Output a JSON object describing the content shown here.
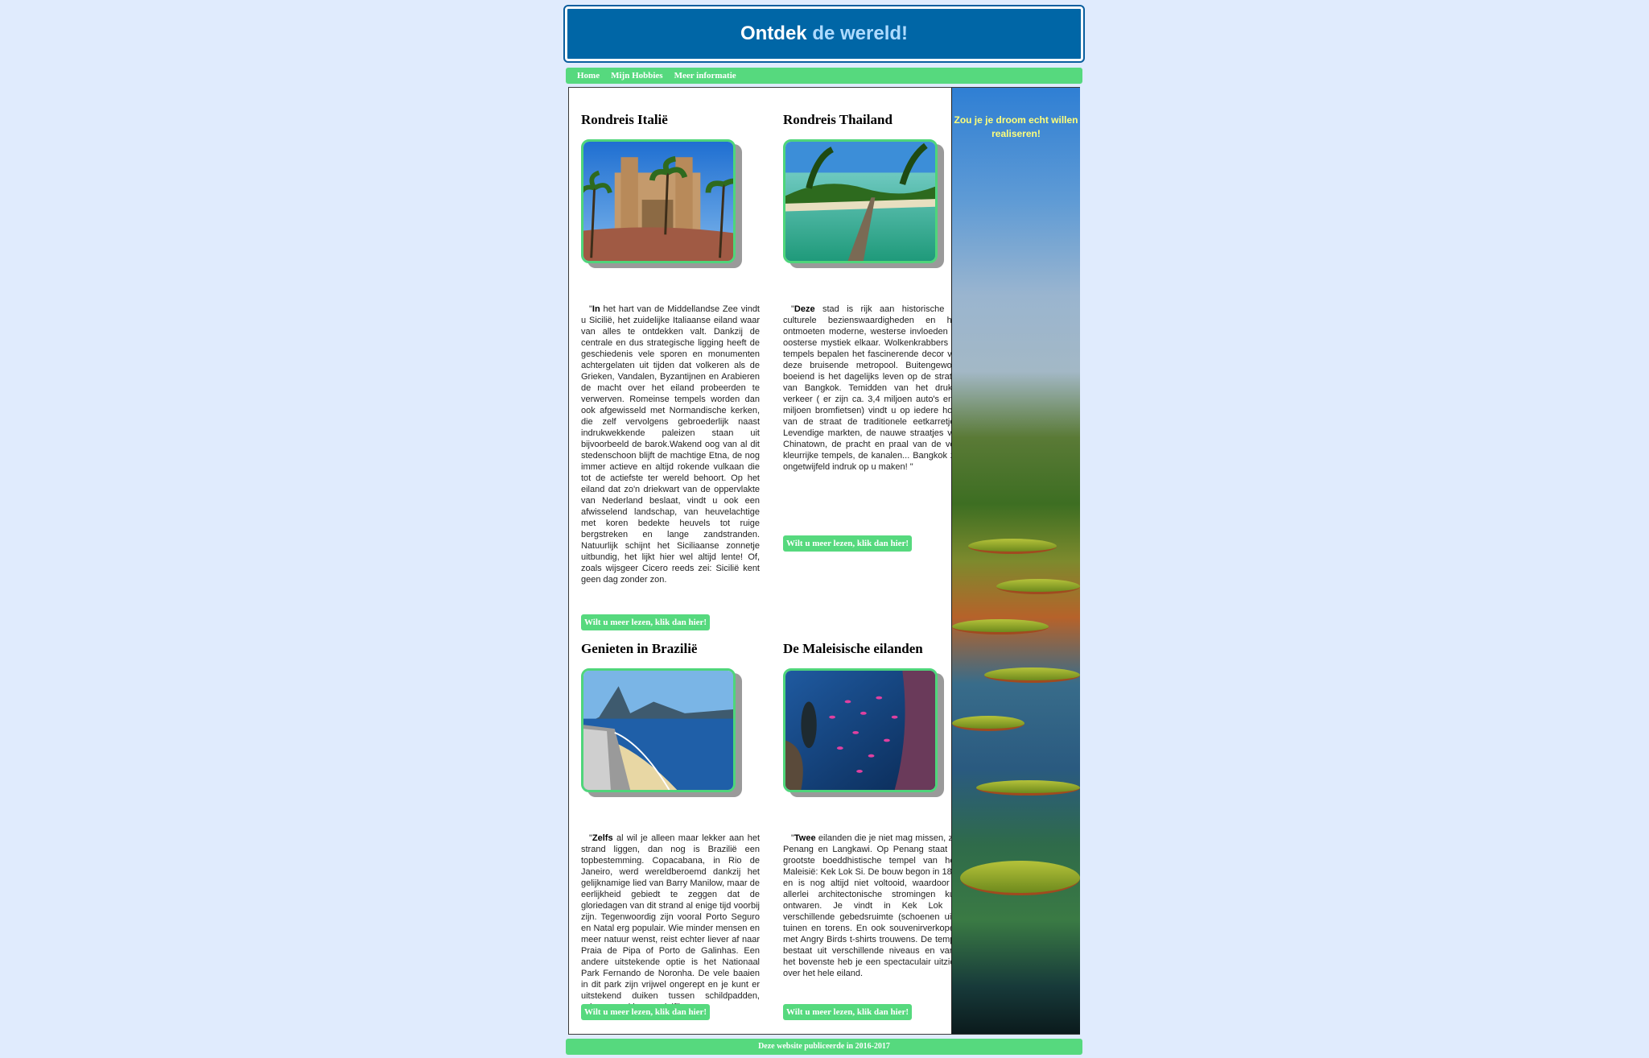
{
  "header": {
    "title_part1": "Ontdek",
    "title_part2": " de wereld!"
  },
  "nav": {
    "items": [
      "Home",
      "Mijn Hobbies",
      "Meer informatie"
    ]
  },
  "sidebar": {
    "slogan": "Zou je je droom echt willen realiseren!"
  },
  "cards": [
    {
      "title": "Rondreis Italië",
      "lead": "In",
      "text": " het hart van de Middellandse Zee vindt u Sicilië, het zuidelijke Italiaanse eiland waar van alles te ontdekken valt. Dankzij de centrale en dus strategische ligging heeft de geschiedenis vele sporen en monumenten achtergelaten uit tijden dat volkeren als de Grieken, Vandalen, Byzantijnen en Arabieren de macht over het eiland probeerden te verwerven. Romeinse tempels worden dan ook afgewisseld met Normandische kerken, die zelf vervolgens gebroederlijk naast indrukwekkende paleizen staan uit bijvoorbeeld de barok.Wakend oog van al dit stedenschoon blijft de machtige Etna, de nog immer actieve en altijd rokende vulkaan die tot de actiefste ter wereld behoort. Op het eiland dat zo'n driekwart van de oppervlakte van Nederland beslaat, vindt u ook een afwisselend landschap, van heuvelachtige met koren bedekte heuvels tot ruige bergstreken en lange zandstranden. Natuurlijk schijnt het Siciliaanse zonnetje uitbundig, het lijkt hier wel altijd lente! Of, zoals wijsgeer Cicero reeds zei: Sicilië kent geen dag zonder zon.",
      "button": "Wilt u meer lezen, klik dan hier!"
    },
    {
      "title": "Rondreis Thailand",
      "lead": "Deze",
      "text": " stad is rijk aan historische en culturele bezienswaardigheden en hier ontmoeten moderne, westerse invloeden en oosterse mystiek elkaar. Wolkenkrabbers en tempels bepalen het fascinerende decor van deze bruisende metropool. Buitengewoon boeiend is het dagelijks leven op de straten van Bangkok. Temidden van het drukke verkeer ( er zijn ca. 3,4 miljoen auto's en 3 miljoen bromfietsen) vindt u op iedere hoek van de straat de traditionele eetkarretjes. Levendige markten, de nauwe straatjes van Chinatown, de pracht en praal van de vele kleurrijke tempels, de kanalen... Bangkok zal ongetwijfeld indruk op u maken! \"",
      "button": "Wilt u meer lezen, klik dan hier!"
    },
    {
      "title": "Genieten in Brazilië",
      "lead": "Zelfs",
      "text": " al wil je alleen maar lekker aan het strand liggen, dan nog is Brazilië een topbestemming. Copacabana, in Rio de Janeiro, werd wereldberoemd dankzij het gelijknamige lied van Barry Manilow, maar de eerlijkheid gebiedt te zeggen dat de gloriedagen van dit strand al enige tijd voorbij zijn. Tegenwoordig zijn vooral Porto Seguro en Natal erg populair. Wie minder mensen en meer natuur wenst, reist echter liever af naar Praia de Pipa of Porto de Galinhas. Een andere uitstekende optie is het Nationaal Park Fernando de Noronha. De vele baaien in dit park zijn vrijwel ongerept en je kunt er uitstekend duiken tussen schildpadden, scheepswrakken en dolfijnen.",
      "button": "Wilt u meer lezen, klik dan hier!"
    },
    {
      "title": "De Maleisische eilanden",
      "lead": "Twee",
      "text": " eilanden die je niet mag missen, zijn Penang en Langkawi. Op Penang staat de grootste boeddhistische tempel van heel Maleisië: Kek Lok Si. De bouw begon in 1883 en is nog altijd niet voltooid, waardoor je allerlei architectonische stromingen kunt ontwaren. Je vindt in Kek Lok Si verschillende gebedsruimte (schoenen uit!), tuinen en torens. En ook souvenirverkopers met Angry Birds t-shirts trouwens. De tempel bestaat uit verschillende niveaus en vanaf het bovenste heb je een spectaculair uitzicht over het hele eiland.",
      "button": "Wilt u meer lezen, klik dan hier!"
    }
  ],
  "footer": {
    "text": "Deze website publiceerde in 2016-2017"
  }
}
